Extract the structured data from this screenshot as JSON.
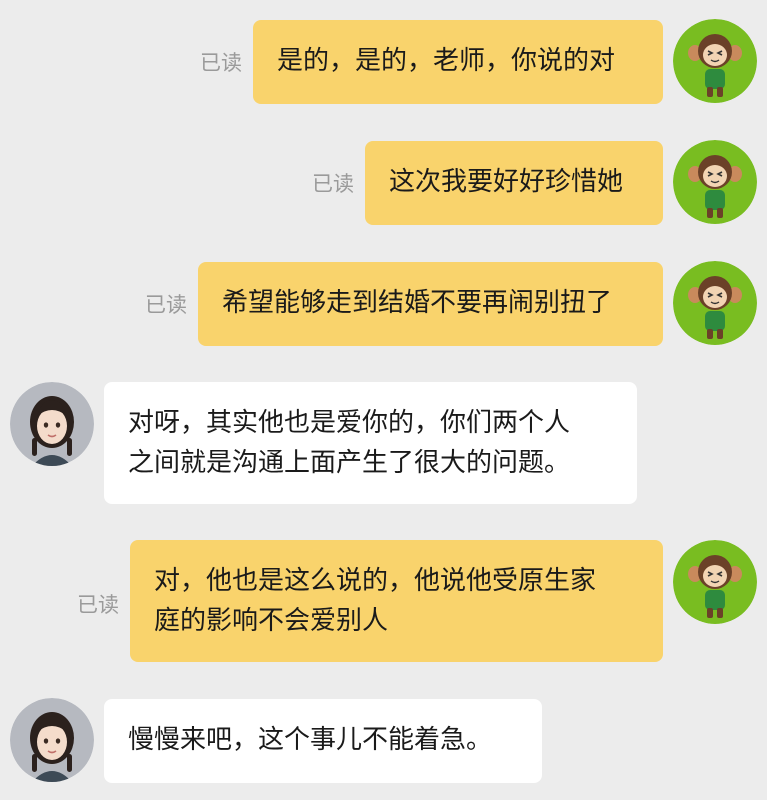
{
  "read_label": "已读",
  "avatars": {
    "self": {
      "icon": "monkey-avatar-icon",
      "bg": "#79bd21"
    },
    "other": {
      "icon": "girl-avatar-icon",
      "bg": "#b6b9c0"
    }
  },
  "colors": {
    "self_bubble": "#f9d36c",
    "other_bubble": "#ffffff",
    "background": "#ececec",
    "read_text": "#9a9a9a"
  },
  "messages": [
    {
      "sender": "self",
      "text": "是的，是的，老师，你说的对",
      "read": true
    },
    {
      "sender": "self",
      "text": "这次我要好好珍惜她",
      "read": true
    },
    {
      "sender": "self",
      "text": "希望能够走到结婚不要再闹别扭了",
      "read": true
    },
    {
      "sender": "other",
      "text": "对呀，其实他也是爱你的，你们两个人\n之间就是沟通上面产生了很大的问题。"
    },
    {
      "sender": "self",
      "text": "对，他也是这么说的，他说他受原生家\n庭的影响不会爱别人",
      "read": true
    },
    {
      "sender": "other",
      "text": "慢慢来吧，这个事儿不能着急。"
    }
  ]
}
